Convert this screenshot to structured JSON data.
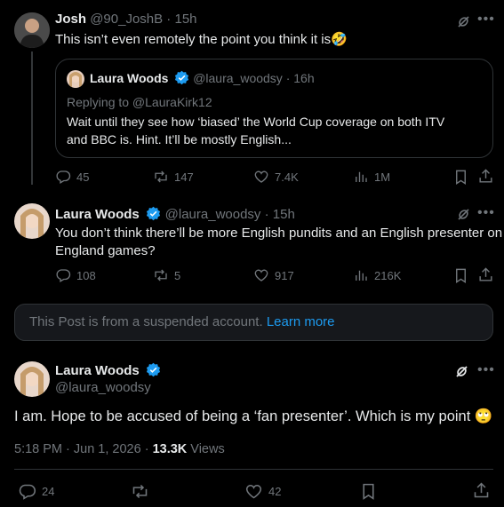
{
  "tweet1": {
    "name": "Josh",
    "handle": "@90_JoshB",
    "time": "15h",
    "text": "This isn’t even remotely the point you think it is",
    "emoji": "🤣",
    "quote": {
      "name": "Laura Woods",
      "handle": "@laura_woodsy",
      "time": "16h",
      "replying": "Replying to @LauraKirk12",
      "line1": "Wait until they see how ‘biased’ the World Cup coverage on both ITV",
      "line2": "and BBC is. Hint. It’ll be mostly English..."
    },
    "replies": "45",
    "reposts": "147",
    "likes": "7.4K",
    "views": "1M"
  },
  "tweet2": {
    "name": "Laura Woods",
    "handle": "@laura_woodsy",
    "time": "15h",
    "line1": "You don’t think there’ll be more English pundits and an English presenter on",
    "line2": "England games?",
    "replies": "108",
    "reposts": "5",
    "likes": "917",
    "views": "216K"
  },
  "suspended": {
    "text": "This Post is from a suspended account.",
    "link": "Learn more"
  },
  "main": {
    "name": "Laura Woods",
    "handle": "@laura_woodsy",
    "text": "I am. Hope to be accused of being a ‘fan presenter’. Which is my point",
    "emoji": "🙄",
    "datetime": "5:18 PM · Jun 1, 2026 · ",
    "views_count": "13.3K",
    "views_label": " Views",
    "replies": "24",
    "likes": "42"
  },
  "colors": {
    "accent": "#1d9bf0",
    "verified": "#1d9bf0",
    "muted": "#71767b",
    "border": "#2f3336"
  }
}
